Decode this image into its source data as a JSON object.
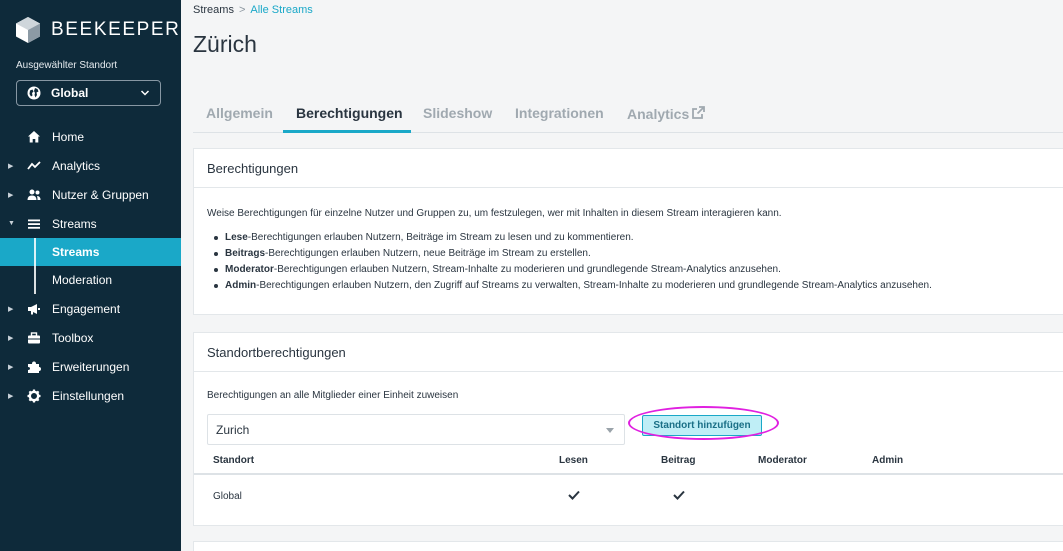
{
  "brand": {
    "name": "BEEKEEPER"
  },
  "sidebar": {
    "location_label": "Ausgewählter Standort",
    "location_value": "Global",
    "items": [
      {
        "label": "Home",
        "icon": "home-icon"
      },
      {
        "label": "Analytics",
        "icon": "analytics-icon"
      },
      {
        "label": "Nutzer & Gruppen",
        "icon": "users-icon"
      },
      {
        "label": "Streams",
        "icon": "streams-icon"
      },
      {
        "label": "Engagement",
        "icon": "megaphone-icon"
      },
      {
        "label": "Toolbox",
        "icon": "toolbox-icon"
      },
      {
        "label": "Erweiterungen",
        "icon": "puzzle-icon"
      },
      {
        "label": "Einstellungen",
        "icon": "gear-icon"
      }
    ],
    "sub_items": [
      {
        "label": "Streams",
        "active": true
      },
      {
        "label": "Moderation",
        "active": false
      }
    ]
  },
  "breadcrumb": {
    "root": "Streams",
    "separator": ">",
    "current": "Alle Streams"
  },
  "page_title": "Zürich",
  "tabs": [
    {
      "label": "Allgemein",
      "active": false
    },
    {
      "label": "Berechtigungen",
      "active": true
    },
    {
      "label": "Slideshow",
      "active": false
    },
    {
      "label": "Integrationen",
      "active": false
    },
    {
      "label": "Analytics",
      "active": false
    }
  ],
  "permissions_card": {
    "title": "Berechtigungen",
    "intro": "Weise Berechtigungen für einzelne Nutzer und Gruppen zu, um festzulegen, wer mit Inhalten in diesem Stream interagieren kann.",
    "bullets": [
      {
        "bold": "Lese",
        "text": "-Berechtigungen erlauben Nutzern, Beiträge im Stream zu lesen und zu kommentieren."
      },
      {
        "bold": "Beitrags",
        "text": "-Berechtigungen erlauben Nutzern, neue Beiträge im Stream zu erstellen."
      },
      {
        "bold": "Moderator",
        "text": "-Berechtigungen erlauben Nutzern, Stream-Inhalte zu moderieren und grundlegende Stream-Analytics anzusehen."
      },
      {
        "bold": "Admin",
        "text": "-Berechtigungen erlauben Nutzern, den Zugriff auf Streams zu verwalten, Stream-Inhalte zu moderieren und grundlegende Stream-Analytics anzusehen."
      }
    ]
  },
  "location_card": {
    "title": "Standortberechtigungen",
    "assign_label": "Berechtigungen an alle Mitglieder einer Einheit zuweisen",
    "select_value": "Zurich",
    "add_button": "Standort hinzufügen",
    "columns": [
      "Standort",
      "Lesen",
      "Beitrag",
      "Moderator",
      "Admin"
    ],
    "rows": [
      {
        "location": "Global",
        "lesen": true,
        "beitrag": true,
        "moderator": false,
        "admin": false
      }
    ]
  },
  "colors": {
    "sidebar_bg": "#0e2a3a",
    "accent": "#1aa8c8",
    "highlight_ring": "#e020e0"
  }
}
